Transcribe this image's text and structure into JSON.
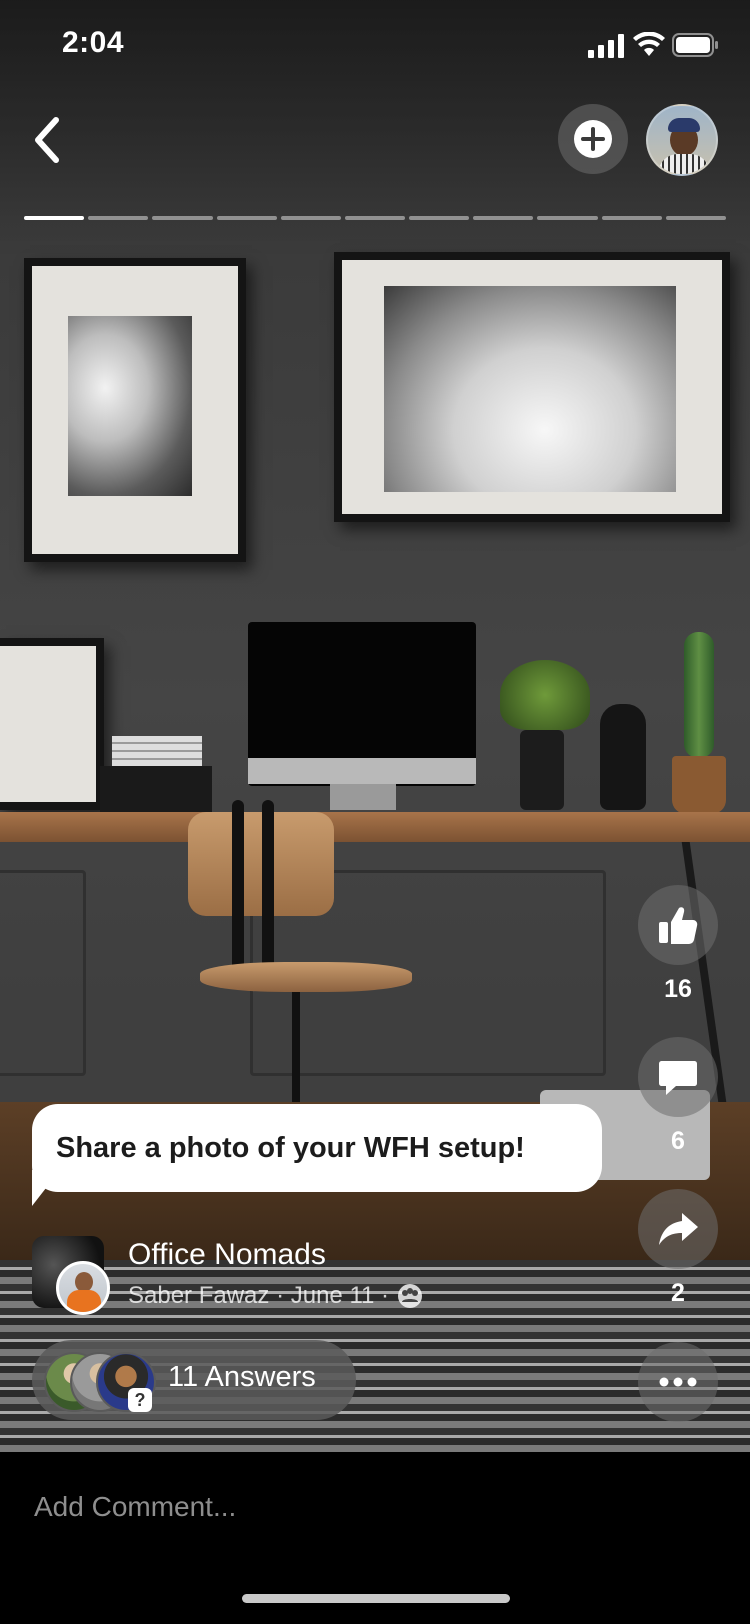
{
  "status_bar": {
    "time": "2:04",
    "signal_icon": "signal-bars-icon",
    "wifi_icon": "wifi-icon",
    "battery_icon": "battery-icon"
  },
  "header": {
    "back_icon": "chevron-left-icon",
    "add_icon": "plus-circle-icon",
    "avatar": "user-avatar"
  },
  "story_progress": {
    "segments": 11,
    "active_index": 0
  },
  "actions": {
    "like": {
      "icon": "thumbs-up-icon",
      "count": "16"
    },
    "comment": {
      "icon": "comment-bubble-icon",
      "count": "6"
    },
    "share": {
      "icon": "share-arrow-icon",
      "count": "2"
    },
    "more": {
      "icon": "more-dots-icon"
    }
  },
  "prompt": {
    "text": "Share a photo of your WFH setup!"
  },
  "post": {
    "group_name": "Office Nomads",
    "meta": "Saber Fawaz · June 11 ·",
    "privacy_icon": "group-members-icon"
  },
  "answers": {
    "label": "11 Answers",
    "badge_icon": "question-mark-icon"
  },
  "comment": {
    "placeholder": "Add Comment..."
  },
  "colors": {
    "bubble": "#ffffff",
    "pill": "#5a5a5a",
    "background": "#000000"
  }
}
